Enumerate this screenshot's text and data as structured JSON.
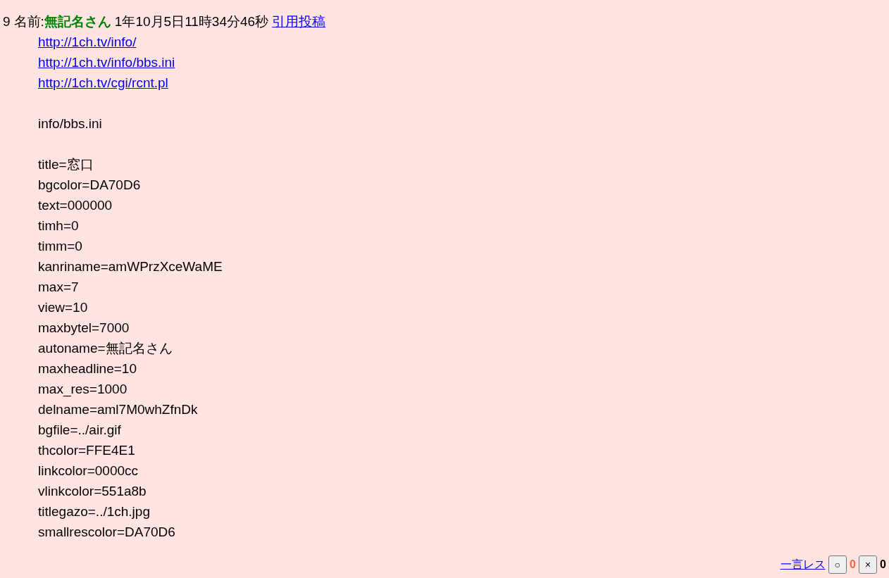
{
  "post": {
    "number": "9",
    "name_label": "名前:",
    "name": "無記名さん",
    "date": "1年10月5日11時34分46秒",
    "quote_link": "引用投稿"
  },
  "links": [
    "http://1ch.tv/info/",
    "http://1ch.tv/info/bbs.ini",
    "http://1ch.tv/cgi/rcnt.pl"
  ],
  "file_label": "info/bbs.ini",
  "settings": [
    "title=窓口",
    "bgcolor=DA70D6",
    "text=000000",
    "timh=0",
    "timm=0",
    "kanriname=amWPrzXceWaME",
    "max=7",
    "view=10",
    "maxbytel=7000",
    "autoname=無記名さん",
    "maxheadline=10",
    "max_res=1000",
    "delname=aml7M0whZfnDk",
    "bgfile=../air.gif",
    "thcolor=FFE4E1",
    "linkcolor=0000cc",
    "vlinkcolor=551a8b",
    "titlegazo=../1ch.jpg",
    "smallrescolor=DA70D6"
  ],
  "footer": {
    "reply_link": "一言レス",
    "good_button": "○",
    "good_count": "0",
    "bad_button": "×",
    "bad_count": "0"
  }
}
